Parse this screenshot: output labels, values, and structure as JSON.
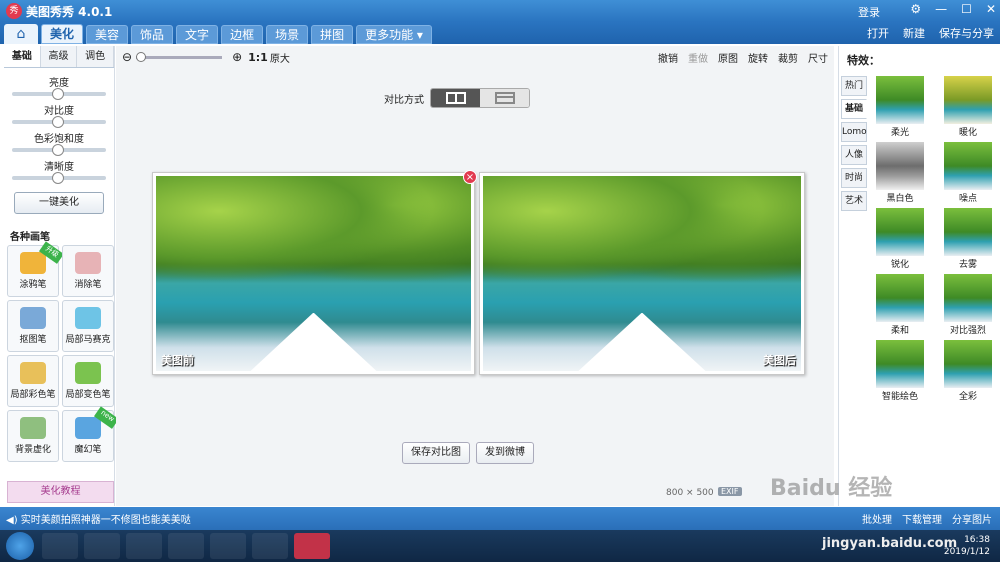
{
  "window": {
    "app_logo": "秀",
    "title": "美图秀秀 4.0.1",
    "login": "登录",
    "ctrl_skin": "⚙",
    "ctrl_min": "—",
    "ctrl_max": "☐",
    "ctrl_close": "✕"
  },
  "menu": {
    "home_icon": "⌂",
    "tabs": [
      "美化",
      "美容",
      "饰品",
      "文字",
      "边框",
      "场景",
      "拼图",
      "更多功能 ▾"
    ],
    "open": "打开",
    "new": "新建",
    "save_share": "保存与分享"
  },
  "left": {
    "subtabs": [
      "基础",
      "高级",
      "调色"
    ],
    "sliders": [
      "亮度",
      "对比度",
      "色彩饱和度",
      "清晰度"
    ],
    "onekey": "一键美化",
    "brush_title": "各种画笔",
    "brushes": [
      "涂鸦笔",
      "消除笔",
      "抠图笔",
      "局部马赛克",
      "局部彩色笔",
      "局部变色笔",
      "背景虚化",
      "魔幻笔"
    ],
    "badge_upgrade": "升级",
    "badge_new": "new",
    "tutorial": "美化教程"
  },
  "center": {
    "zoom_ratio": "1:1",
    "zoom_orig": "原大",
    "tools": [
      "撤销",
      "重做",
      "原图",
      "旋转",
      "裁剪",
      "尺寸"
    ],
    "compare_label": "对比方式",
    "before_label": "美图前",
    "after_label": "美图后",
    "save_compare": "保存对比图",
    "send_weibo": "发到微博",
    "img_size": "800 × 500",
    "exif": "EXIF"
  },
  "right": {
    "title": "特效：",
    "vtabs": [
      "热门",
      "基础",
      "Lomo",
      "人像",
      "时尚",
      "艺术"
    ],
    "effects": [
      "柔光",
      "暖化",
      "黑白色",
      "噪点",
      "锐化",
      "去雾",
      "柔和",
      "对比强烈",
      "智能绘色",
      "全彩"
    ]
  },
  "status": {
    "text": "◀) 实时美颜拍照神器一不修图也能美美哒",
    "batch": "批处理",
    "download": "下载管理",
    "share": "分享图片"
  },
  "taskbar": {
    "time": "16:38",
    "date": "2019/1/12"
  },
  "watermark": {
    "logo": "Baidu 经验",
    "url": "jingyan.baidu.com"
  }
}
